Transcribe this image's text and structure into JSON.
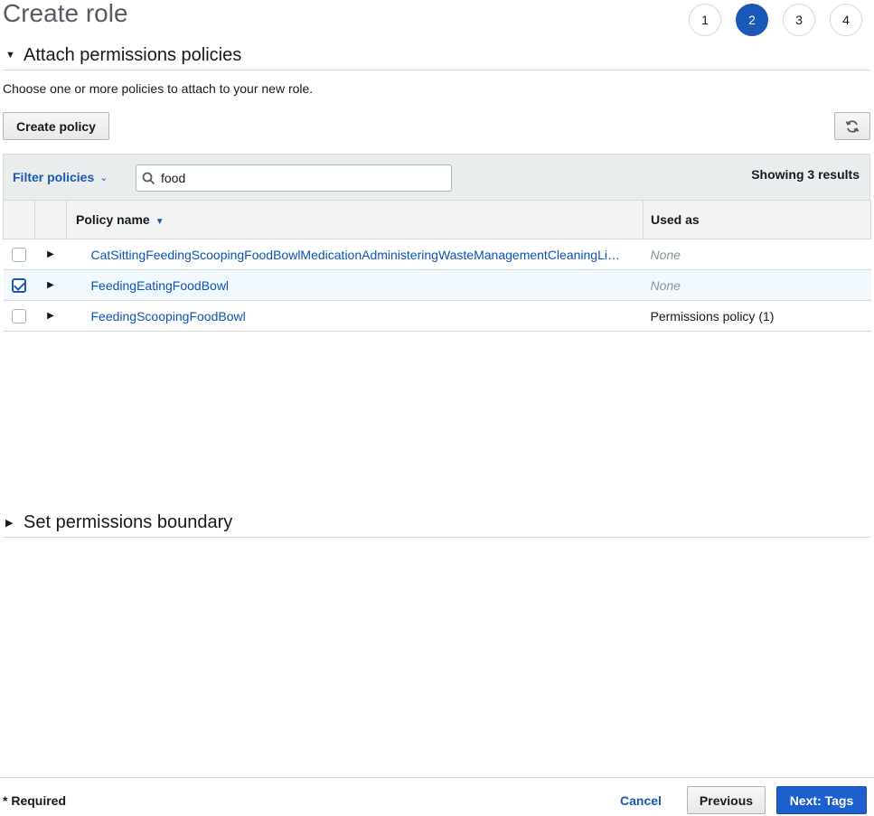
{
  "page": {
    "title": "Create role"
  },
  "steps": [
    {
      "label": "1",
      "active": false
    },
    {
      "label": "2",
      "active": true
    },
    {
      "label": "3",
      "active": false
    },
    {
      "label": "4",
      "active": false
    }
  ],
  "attach_section": {
    "title": "Attach permissions policies",
    "description": "Choose one or more policies to attach to your new role.",
    "create_policy_label": "Create policy",
    "refresh_icon": "refresh-icon"
  },
  "filter": {
    "dropdown_label": "Filter policies",
    "search_value": "food",
    "result_count": "Showing 3 results"
  },
  "table": {
    "columns": {
      "policy_name": "Policy name",
      "used_as": "Used as"
    },
    "rows": [
      {
        "checked": false,
        "name": "CatSittingFeedingScoopingFoodBowlMedicationAdministeringWasteManagementCleaningLi…",
        "used_as": "None"
      },
      {
        "checked": true,
        "name": "FeedingEatingFoodBowl",
        "used_as": "None"
      },
      {
        "checked": false,
        "name": "FeedingScoopingFoodBowl",
        "used_as": "Permissions policy (1)"
      }
    ]
  },
  "boundary_section": {
    "title": "Set permissions boundary"
  },
  "footer": {
    "required_label": "* Required",
    "cancel_label": "Cancel",
    "previous_label": "Previous",
    "next_label": "Next: Tags"
  }
}
